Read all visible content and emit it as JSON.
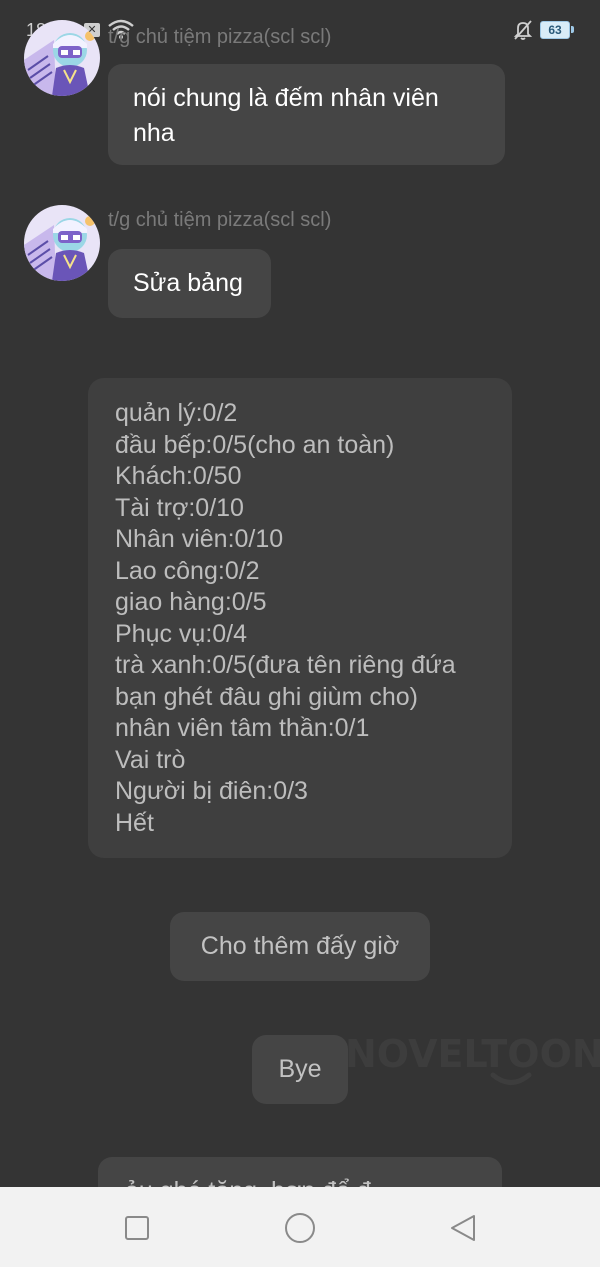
{
  "status_bar": {
    "time": "18:",
    "notification_badge": "✕",
    "battery_level": "63",
    "icons": [
      "x-notification-icon",
      "wifi-icon",
      "bell-muted-icon",
      "battery-icon"
    ]
  },
  "messages": [
    {
      "sender": "t/g chủ tiệm pizza(scl scl)",
      "text": "nói chung là đếm nhân viên nha"
    },
    {
      "sender": "t/g chủ tiệm pizza(scl scl)",
      "text": "Sửa bảng"
    }
  ],
  "list_card": {
    "lines": [
      "quản lý:0/2",
      "đầu bếp:0/5(cho an toàn)",
      "Khách:0/50",
      "Tài trợ:0/10",
      "Nhân viên:0/10",
      "Lao công:0/2",
      "giao hàng:0/5",
      "Phục vụ:0/4",
      "trà xanh:0/5(đưa tên riêng đứa",
      "bạn ghét đâu ghi giùm cho)",
      "nhân viên tâm thần:0/1",
      "Vai trò",
      "Người bị điên:0/3",
      "Hết"
    ]
  },
  "center_messages": {
    "more": "Cho thêm đấy giờ",
    "bye": "Bye",
    "cut_off": "ảu ghé tăng, hơn để đ..."
  },
  "watermark": "NOVELTOON",
  "nav_bar": {
    "buttons": [
      "recent-apps-square-icon",
      "home-circle-icon",
      "back-triangle-icon"
    ]
  },
  "colors": {
    "background": "#343434",
    "bubble": "#454545",
    "nav_background": "#f2f2f2"
  }
}
